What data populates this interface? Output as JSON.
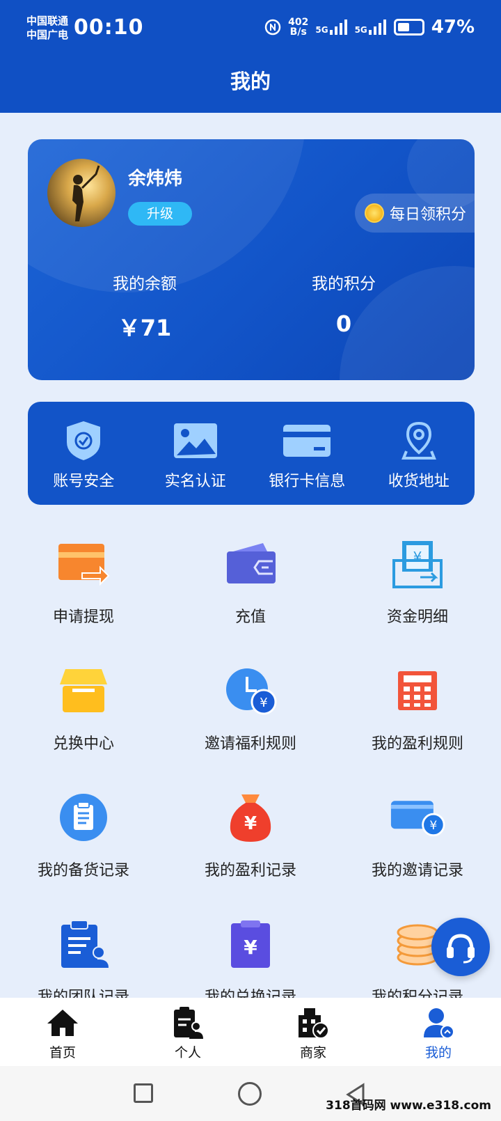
{
  "status": {
    "carrier1": "中国联通",
    "carrier2": "中国广电",
    "time": "00:10",
    "net_speed_value": "402",
    "net_speed_unit": "B/s",
    "signal1_label": "5G",
    "signal2_label": "5G",
    "battery": "47%"
  },
  "header": {
    "title": "我的"
  },
  "profile": {
    "name": "余炜炜",
    "upgrade_label": "升级",
    "daily_points_label": "每日领积分",
    "balance_label": "我的余额",
    "balance_value": "￥71",
    "points_label": "我的积分",
    "points_value": "0"
  },
  "quick_actions": [
    {
      "label": "账号安全",
      "icon": "shield-check-icon"
    },
    {
      "label": "实名认证",
      "icon": "image-icon"
    },
    {
      "label": "银行卡信息",
      "icon": "bank-card-icon"
    },
    {
      "label": "收货地址",
      "icon": "location-pin-icon"
    }
  ],
  "menu": [
    {
      "label": "申请提现",
      "icon": "withdraw-card-icon"
    },
    {
      "label": "充值",
      "icon": "wallet-icon"
    },
    {
      "label": "资金明细",
      "icon": "fund-details-icon"
    },
    {
      "label": "兑换中心",
      "icon": "store-icon"
    },
    {
      "label": "邀请福利规则",
      "icon": "clock-yen-icon"
    },
    {
      "label": "我的盈利规则",
      "icon": "calculator-icon"
    },
    {
      "label": "我的备货记录",
      "icon": "clipboard-icon"
    },
    {
      "label": "我的盈利记录",
      "icon": "money-bag-icon"
    },
    {
      "label": "我的邀请记录",
      "icon": "wallet-yen-icon"
    },
    {
      "label": "我的团队记录",
      "icon": "team-doc-icon"
    },
    {
      "label": "我的兑换记录",
      "icon": "yen-clipboard-icon"
    },
    {
      "label": "我的积分记录",
      "icon": "coins-icon"
    }
  ],
  "tabs": [
    {
      "label": "首页",
      "icon": "home-icon"
    },
    {
      "label": "个人",
      "icon": "personal-doc-icon"
    },
    {
      "label": "商家",
      "icon": "merchant-building-icon"
    },
    {
      "label": "我的",
      "icon": "user-icon",
      "active": true
    }
  ],
  "watermark": "318首码网 www.e318.com",
  "colors": {
    "primary": "#1050c4",
    "accent": "#2fb8f5",
    "background": "#e6eefb"
  }
}
